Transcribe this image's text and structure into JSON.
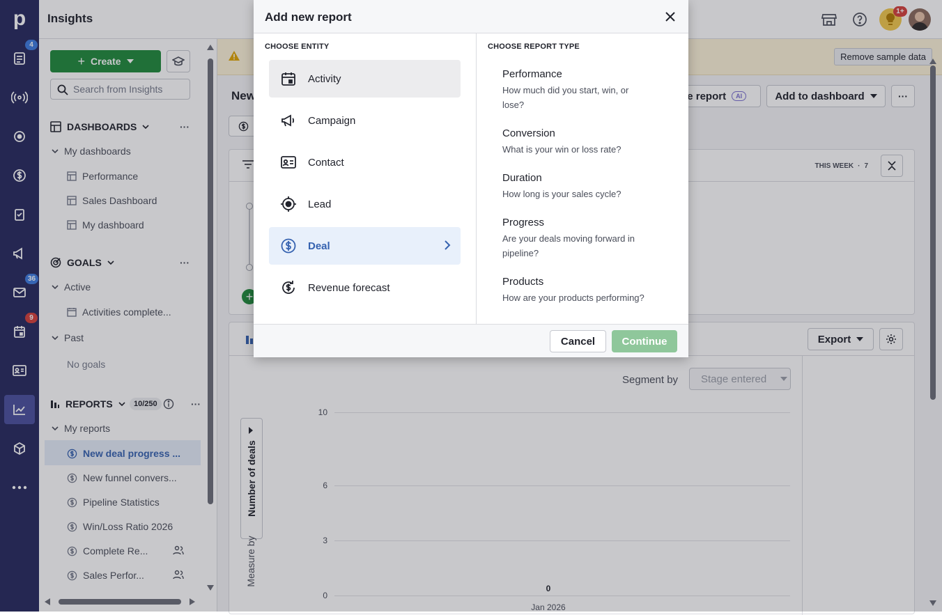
{
  "app": {
    "logo": "p",
    "title": "Insights"
  },
  "rail": {
    "badges": {
      "deals": "4",
      "mail": "36",
      "calendar": "9"
    }
  },
  "topbar": {
    "notif_badge": "1+"
  },
  "sidebar": {
    "create_label": "Create",
    "search_placeholder": "Search from Insights",
    "dashboards": {
      "title": "DASHBOARDS",
      "group": "My dashboards",
      "items": [
        "Performance",
        "Sales Dashboard",
        "My dashboard"
      ]
    },
    "goals": {
      "title": "GOALS",
      "active": "Active",
      "active_items": [
        "Activities complete..."
      ],
      "past": "Past",
      "past_empty": "No goals"
    },
    "reports": {
      "title": "REPORTS",
      "count": "10/250",
      "group": "My reports",
      "items": [
        "New deal progress ...",
        "New funnel convers...",
        "Pipeline Statistics",
        "Win/Loss Ratio 2026",
        "Complete Re...",
        "Sales Perfor..."
      ]
    }
  },
  "main": {
    "page_title_partial": "New",
    "remove_sample": "Remove sample data",
    "create_report_partial": "ate report",
    "ai_badge": "AI",
    "add_dashboard": "Add to dashboard",
    "period": "THIS WEEK",
    "period_sep": "·",
    "period_count": "7",
    "export": "Export",
    "segment_label": "Segment by",
    "segment_value": "Stage entered",
    "measure_label": "Measure by",
    "y_axis_label": "Number of deals"
  },
  "chart_data": {
    "type": "bar",
    "categories": [
      "Jan 2026"
    ],
    "values": [
      0
    ],
    "ylabel": "Number of deals",
    "yticks": [
      0,
      3,
      6,
      10
    ],
    "ylim": [
      0,
      10
    ],
    "data_labels": [
      "0"
    ]
  },
  "modal": {
    "title": "Add new report",
    "entity_title": "CHOOSE ENTITY",
    "entities": [
      "Activity",
      "Campaign",
      "Contact",
      "Lead",
      "Deal",
      "Revenue forecast"
    ],
    "type_title": "CHOOSE REPORT TYPE",
    "types": [
      {
        "title": "Performance",
        "desc1": "How much did you start, win, or",
        "desc2": "lose?"
      },
      {
        "title": "Conversion",
        "desc1": "What is your win or loss rate?",
        "desc2": ""
      },
      {
        "title": "Duration",
        "desc1": "How long is your sales cycle?",
        "desc2": ""
      },
      {
        "title": "Progress",
        "desc1": "Are your deals moving forward in",
        "desc2": "pipeline?"
      },
      {
        "title": "Products",
        "desc1": "How are your products performing?",
        "desc2": ""
      }
    ],
    "cancel": "Cancel",
    "continue": "Continue"
  }
}
